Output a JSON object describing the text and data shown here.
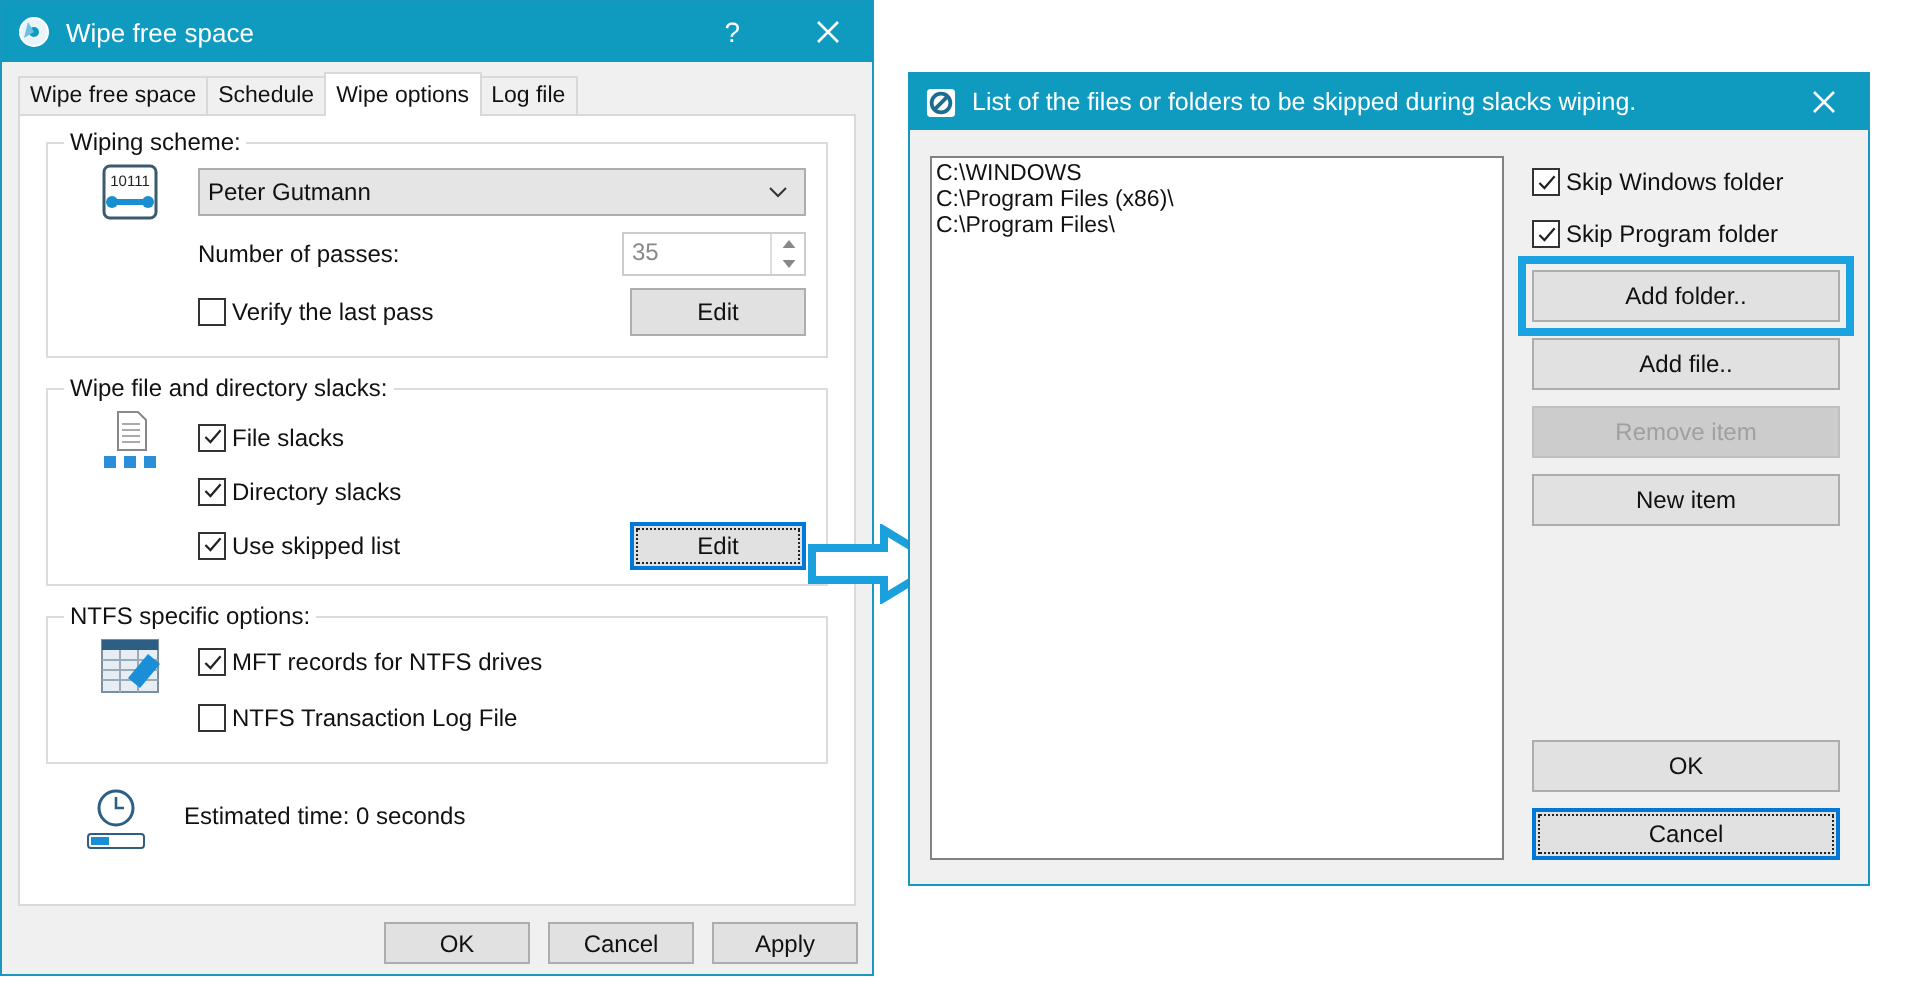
{
  "main_window": {
    "title": "Wipe free space",
    "help_button": "?",
    "tabs": [
      {
        "label": "Wipe free space",
        "selected": false
      },
      {
        "label": "Schedule",
        "selected": false
      },
      {
        "label": "Wipe options",
        "selected": true
      },
      {
        "label": "Log file",
        "selected": false
      }
    ],
    "wiping_scheme": {
      "label": "Wiping scheme:",
      "icon_text": "10111",
      "scheme": "Peter Gutmann",
      "passes_label": "Number of passes:",
      "passes": "35",
      "passes_disabled": true,
      "verify": {
        "label": "Verify the last pass",
        "checked": false
      },
      "edit_button": {
        "label": "Edit",
        "focused": false
      }
    },
    "slacks": {
      "label": "Wipe file and directory slacks:",
      "options": [
        {
          "label": "File slacks",
          "checked": true
        },
        {
          "label": "Directory slacks",
          "checked": true
        },
        {
          "label": "Use skipped list",
          "checked": true
        }
      ],
      "edit_button": {
        "label": "Edit",
        "focused": true
      }
    },
    "ntfs": {
      "label": "NTFS specific options:",
      "options": [
        {
          "label": "MFT records for NTFS drives",
          "checked": true
        },
        {
          "label": "NTFS Transaction Log File",
          "checked": false
        }
      ]
    },
    "estimated_time": "Estimated time: 0 seconds",
    "buttons": [
      {
        "label": "OK",
        "disabled": false
      },
      {
        "label": "Cancel",
        "disabled": false
      },
      {
        "label": "Apply",
        "disabled": false
      }
    ]
  },
  "skip_dialog": {
    "title": "List of the files or folders to be skipped during slacks wiping.",
    "items": [
      "C:\\WINDOWS",
      "C:\\Program Files (x86)\\",
      "C:\\Program Files\\"
    ],
    "options": [
      {
        "label": "Skip Windows folder",
        "checked": true
      },
      {
        "label": "Skip Program folder",
        "checked": true
      }
    ],
    "buttons": [
      {
        "label": "Add folder..",
        "disabled": false,
        "focused": false,
        "highlighted": true
      },
      {
        "label": "Add file..",
        "disabled": false,
        "focused": false,
        "highlighted": false
      },
      {
        "label": "Remove item",
        "disabled": true,
        "focused": false,
        "highlighted": false
      },
      {
        "label": "New item",
        "disabled": false,
        "focused": false,
        "highlighted": false
      }
    ],
    "dialog_buttons": [
      {
        "label": "OK",
        "disabled": false,
        "focused": false,
        "highlighted": false
      },
      {
        "label": "Cancel",
        "disabled": false,
        "focused": true,
        "highlighted": false
      }
    ]
  }
}
